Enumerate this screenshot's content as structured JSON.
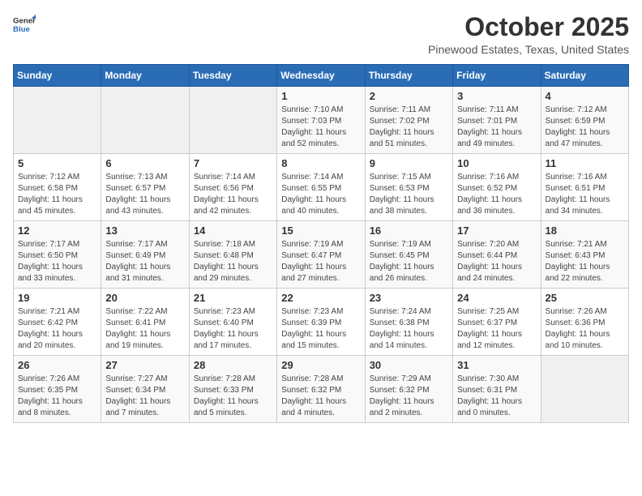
{
  "header": {
    "logo_general": "General",
    "logo_blue": "Blue",
    "month": "October 2025",
    "location": "Pinewood Estates, Texas, United States"
  },
  "days_of_week": [
    "Sunday",
    "Monday",
    "Tuesday",
    "Wednesday",
    "Thursday",
    "Friday",
    "Saturday"
  ],
  "weeks": [
    [
      {
        "day": "",
        "info": ""
      },
      {
        "day": "",
        "info": ""
      },
      {
        "day": "",
        "info": ""
      },
      {
        "day": "1",
        "info": "Sunrise: 7:10 AM\nSunset: 7:03 PM\nDaylight: 11 hours\nand 52 minutes."
      },
      {
        "day": "2",
        "info": "Sunrise: 7:11 AM\nSunset: 7:02 PM\nDaylight: 11 hours\nand 51 minutes."
      },
      {
        "day": "3",
        "info": "Sunrise: 7:11 AM\nSunset: 7:01 PM\nDaylight: 11 hours\nand 49 minutes."
      },
      {
        "day": "4",
        "info": "Sunrise: 7:12 AM\nSunset: 6:59 PM\nDaylight: 11 hours\nand 47 minutes."
      }
    ],
    [
      {
        "day": "5",
        "info": "Sunrise: 7:12 AM\nSunset: 6:58 PM\nDaylight: 11 hours\nand 45 minutes."
      },
      {
        "day": "6",
        "info": "Sunrise: 7:13 AM\nSunset: 6:57 PM\nDaylight: 11 hours\nand 43 minutes."
      },
      {
        "day": "7",
        "info": "Sunrise: 7:14 AM\nSunset: 6:56 PM\nDaylight: 11 hours\nand 42 minutes."
      },
      {
        "day": "8",
        "info": "Sunrise: 7:14 AM\nSunset: 6:55 PM\nDaylight: 11 hours\nand 40 minutes."
      },
      {
        "day": "9",
        "info": "Sunrise: 7:15 AM\nSunset: 6:53 PM\nDaylight: 11 hours\nand 38 minutes."
      },
      {
        "day": "10",
        "info": "Sunrise: 7:16 AM\nSunset: 6:52 PM\nDaylight: 11 hours\nand 36 minutes."
      },
      {
        "day": "11",
        "info": "Sunrise: 7:16 AM\nSunset: 6:51 PM\nDaylight: 11 hours\nand 34 minutes."
      }
    ],
    [
      {
        "day": "12",
        "info": "Sunrise: 7:17 AM\nSunset: 6:50 PM\nDaylight: 11 hours\nand 33 minutes."
      },
      {
        "day": "13",
        "info": "Sunrise: 7:17 AM\nSunset: 6:49 PM\nDaylight: 11 hours\nand 31 minutes."
      },
      {
        "day": "14",
        "info": "Sunrise: 7:18 AM\nSunset: 6:48 PM\nDaylight: 11 hours\nand 29 minutes."
      },
      {
        "day": "15",
        "info": "Sunrise: 7:19 AM\nSunset: 6:47 PM\nDaylight: 11 hours\nand 27 minutes."
      },
      {
        "day": "16",
        "info": "Sunrise: 7:19 AM\nSunset: 6:45 PM\nDaylight: 11 hours\nand 26 minutes."
      },
      {
        "day": "17",
        "info": "Sunrise: 7:20 AM\nSunset: 6:44 PM\nDaylight: 11 hours\nand 24 minutes."
      },
      {
        "day": "18",
        "info": "Sunrise: 7:21 AM\nSunset: 6:43 PM\nDaylight: 11 hours\nand 22 minutes."
      }
    ],
    [
      {
        "day": "19",
        "info": "Sunrise: 7:21 AM\nSunset: 6:42 PM\nDaylight: 11 hours\nand 20 minutes."
      },
      {
        "day": "20",
        "info": "Sunrise: 7:22 AM\nSunset: 6:41 PM\nDaylight: 11 hours\nand 19 minutes."
      },
      {
        "day": "21",
        "info": "Sunrise: 7:23 AM\nSunset: 6:40 PM\nDaylight: 11 hours\nand 17 minutes."
      },
      {
        "day": "22",
        "info": "Sunrise: 7:23 AM\nSunset: 6:39 PM\nDaylight: 11 hours\nand 15 minutes."
      },
      {
        "day": "23",
        "info": "Sunrise: 7:24 AM\nSunset: 6:38 PM\nDaylight: 11 hours\nand 14 minutes."
      },
      {
        "day": "24",
        "info": "Sunrise: 7:25 AM\nSunset: 6:37 PM\nDaylight: 11 hours\nand 12 minutes."
      },
      {
        "day": "25",
        "info": "Sunrise: 7:26 AM\nSunset: 6:36 PM\nDaylight: 11 hours\nand 10 minutes."
      }
    ],
    [
      {
        "day": "26",
        "info": "Sunrise: 7:26 AM\nSunset: 6:35 PM\nDaylight: 11 hours\nand 8 minutes."
      },
      {
        "day": "27",
        "info": "Sunrise: 7:27 AM\nSunset: 6:34 PM\nDaylight: 11 hours\nand 7 minutes."
      },
      {
        "day": "28",
        "info": "Sunrise: 7:28 AM\nSunset: 6:33 PM\nDaylight: 11 hours\nand 5 minutes."
      },
      {
        "day": "29",
        "info": "Sunrise: 7:28 AM\nSunset: 6:32 PM\nDaylight: 11 hours\nand 4 minutes."
      },
      {
        "day": "30",
        "info": "Sunrise: 7:29 AM\nSunset: 6:32 PM\nDaylight: 11 hours\nand 2 minutes."
      },
      {
        "day": "31",
        "info": "Sunrise: 7:30 AM\nSunset: 6:31 PM\nDaylight: 11 hours\nand 0 minutes."
      },
      {
        "day": "",
        "info": ""
      }
    ]
  ]
}
